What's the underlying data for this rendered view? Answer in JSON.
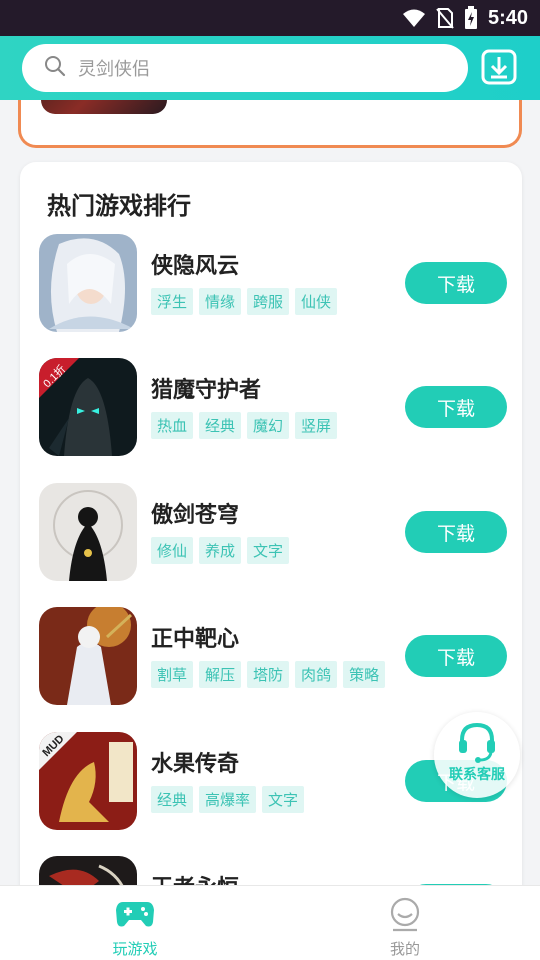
{
  "status_bar": {
    "time": "5:40"
  },
  "header": {
    "search_placeholder": "灵剑侠侣",
    "accent": "#22cdb6"
  },
  "ranking": {
    "title": "热门游戏排行",
    "download_label": "下载",
    "games": [
      {
        "name": "侠隐风云",
        "tags": [
          "浮生",
          "情缘",
          "跨服",
          "仙侠"
        ]
      },
      {
        "name": "猎魔守护者",
        "tags": [
          "热血",
          "经典",
          "魔幻",
          "竖屏"
        ],
        "badge": "0.1折"
      },
      {
        "name": "傲剑苍穹",
        "tags": [
          "修仙",
          "养成",
          "文字"
        ]
      },
      {
        "name": "正中靶心",
        "tags": [
          "割草",
          "解压",
          "塔防",
          "肉鸽",
          "策略"
        ]
      },
      {
        "name": "水果传奇",
        "tags": [
          "经典",
          "高爆率",
          "文字"
        ],
        "badge": "MUD"
      },
      {
        "name": "王者永恒",
        "tags": []
      }
    ]
  },
  "floating_service": {
    "label": "联系客服"
  },
  "bottom_nav": {
    "items": [
      {
        "label": "玩游戏",
        "icon": "gamepad-icon",
        "active": true
      },
      {
        "label": "我的",
        "icon": "profile-icon",
        "active": false
      }
    ]
  },
  "colors": {
    "accent": "#22cdb6",
    "tag_bg": "#dff6f3",
    "prev_card_border": "#f08a52"
  }
}
